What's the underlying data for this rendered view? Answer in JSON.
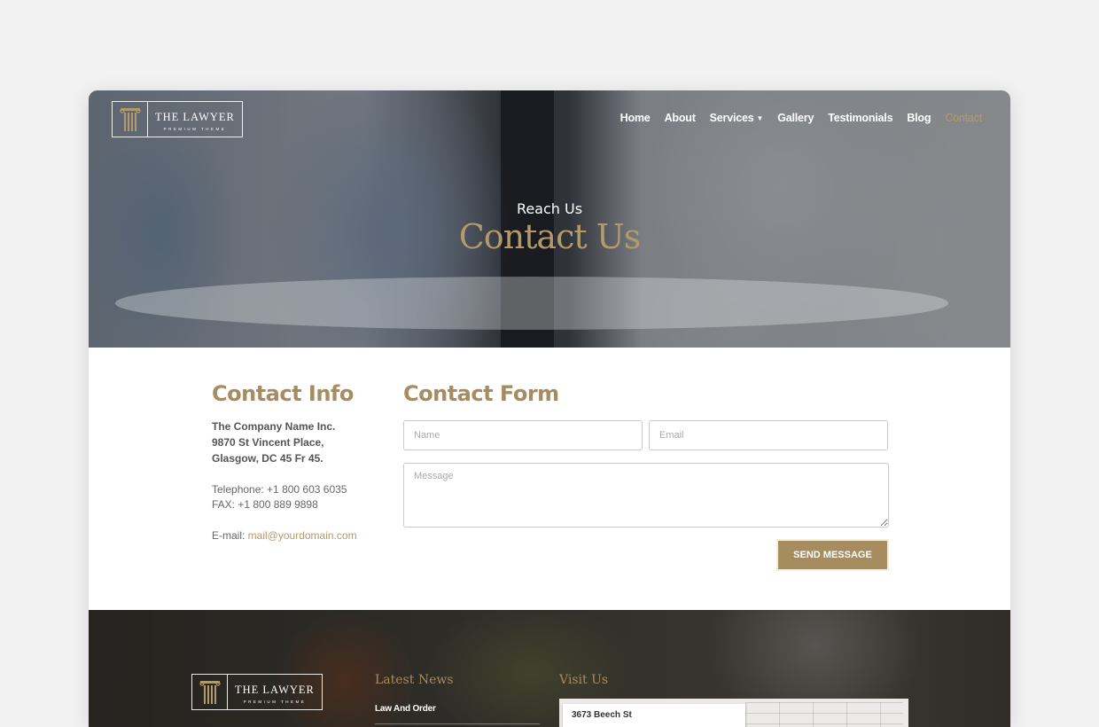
{
  "brand": {
    "name": "THE LAWYER",
    "tagline": "PREMIUM THEME",
    "accent_color": "#a68c5f"
  },
  "nav": {
    "items": [
      {
        "label": "Home",
        "active": false
      },
      {
        "label": "About",
        "active": false
      },
      {
        "label": "Services",
        "active": false,
        "has_dropdown": true,
        "icon": "caret-down-icon"
      },
      {
        "label": "Gallery",
        "active": false
      },
      {
        "label": "Testimonials",
        "active": false
      },
      {
        "label": "Blog",
        "active": false
      },
      {
        "label": "Contact",
        "active": true
      }
    ],
    "caret_glyph": "▼"
  },
  "hero": {
    "subtitle": "Reach Us",
    "title": "Contact Us"
  },
  "contact_info": {
    "title": "Contact Info",
    "company": "The Company Name Inc.",
    "street": "9870 St Vincent Place,",
    "city": "Glasgow, DC 45 Fr 45.",
    "telephone": "Telephone: +1 800 603 6035",
    "fax": "FAX: +1 800 889 9898",
    "email_label": "E-mail: ",
    "email": "mail@yourdomain.com"
  },
  "contact_form": {
    "title": "Contact Form",
    "name_placeholder": "Name",
    "email_placeholder": "Email",
    "message_placeholder": "Message",
    "name_value": "",
    "email_value": "",
    "message_value": "",
    "submit_label": "SEND MESSAGE"
  },
  "footer": {
    "latest_news_title": "Latest News",
    "news_items": [
      "Law And Order"
    ],
    "visit_title": "Visit Us",
    "map_address": "3673 Beech St"
  }
}
